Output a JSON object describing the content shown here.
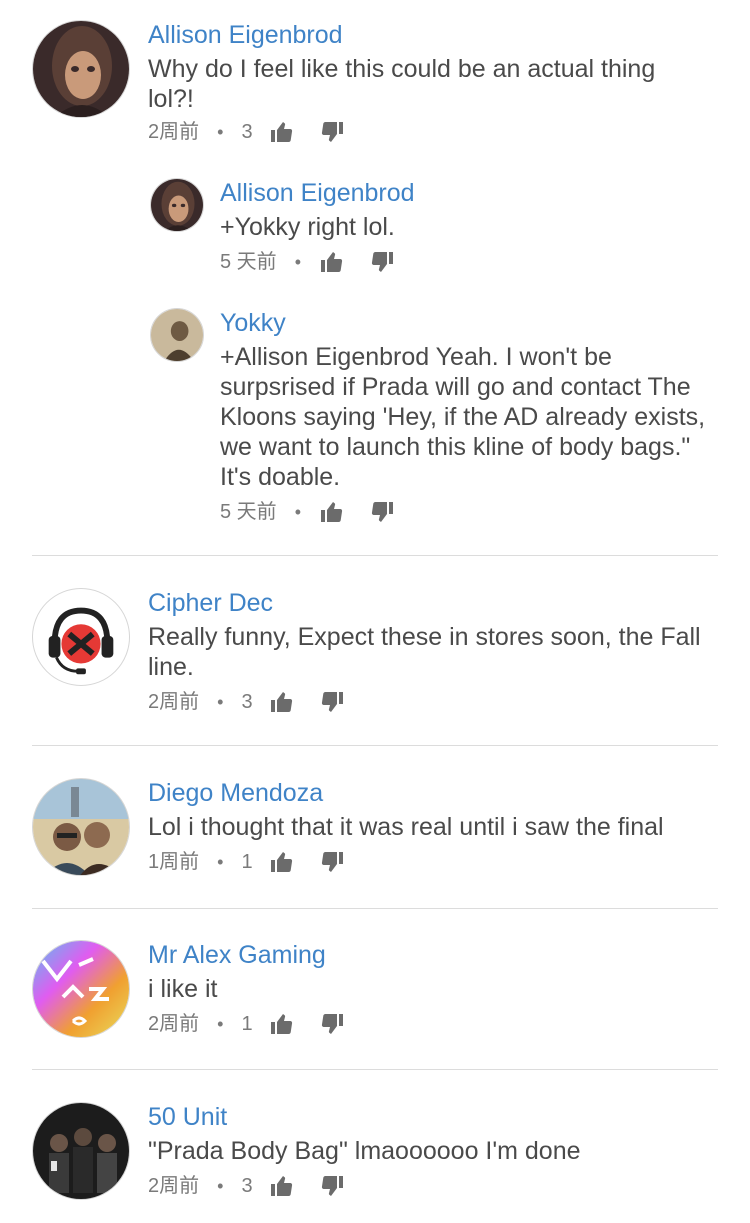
{
  "comments": [
    {
      "author": "Allison Eigenbrod",
      "text": "Why do I feel like this could be an actual thing lol?!",
      "time": "2周前",
      "likes": "3",
      "avatar": "portrait-woman-dark"
    },
    {
      "author": "Allison Eigenbrod",
      "text": "+Yokky right lol.",
      "time": "5 天前",
      "likes": "",
      "avatar": "portrait-woman-dark"
    },
    {
      "author": "Yokky",
      "text": "+Allison Eigenbrod Yeah. I won't be surpsrised if Prada will go and contact The Kloons saying 'Hey, if the AD already exists, we want to launch this kline of body bags.\" It's doable.",
      "time": "5 天前",
      "likes": "",
      "avatar": "portrait-sepia"
    },
    {
      "author": "Cipher Dec",
      "text": "Really funny, Expect these in stores soon, the Fall line.",
      "time": "2周前",
      "likes": "3",
      "avatar": "headset-logo"
    },
    {
      "author": "Diego Mendoza",
      "text": "Lol i thought that it was real until i saw the final",
      "time": "1周前",
      "likes": "1",
      "avatar": "selfie-photo"
    },
    {
      "author": "Mr Alex Gaming",
      "text": "i like it",
      "time": "2周前",
      "likes": "1",
      "avatar": "colorful-logo"
    },
    {
      "author": "50 Unit",
      "text": "\"Prada Body Bag\" lmaoooooo I'm done",
      "time": "2周前",
      "likes": "3",
      "avatar": "group-photo"
    }
  ],
  "dot": "•",
  "icons": {
    "like": "thumbs-up-icon",
    "dislike": "thumbs-down-icon"
  },
  "colors": {
    "author": "#3f83c7",
    "text": "#4a4a4a",
    "meta": "#7a7a7a",
    "divider": "#dcdcdc"
  }
}
